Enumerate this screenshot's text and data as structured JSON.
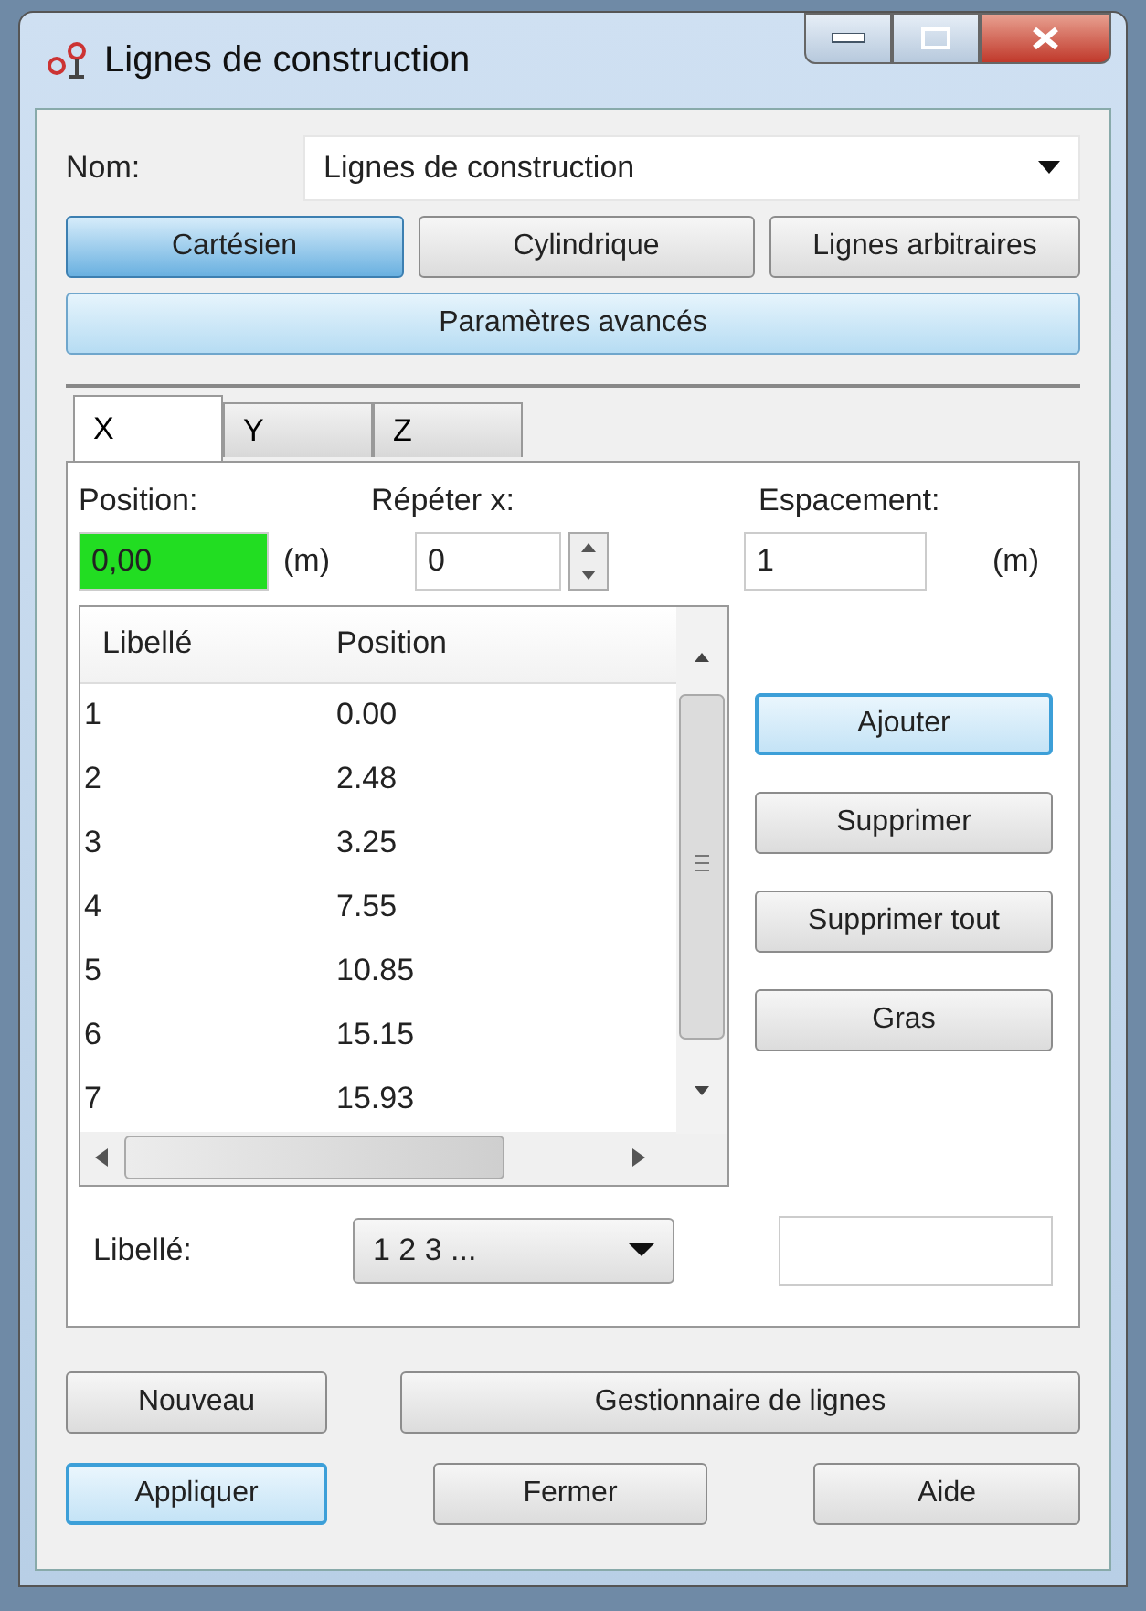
{
  "window": {
    "title": "Lignes de construction"
  },
  "name_field": {
    "label": "Nom:",
    "value": "Lignes de construction"
  },
  "modes": [
    {
      "label": "Cartésien",
      "selected": true
    },
    {
      "label": "Cylindrique",
      "selected": false
    },
    {
      "label": "Lignes arbitraires",
      "selected": false
    }
  ],
  "advanced_button": {
    "label": "Paramètres avancés"
  },
  "tabs": [
    {
      "label": "X",
      "selected": true
    },
    {
      "label": "Y",
      "selected": false
    },
    {
      "label": "Z",
      "selected": false
    }
  ],
  "position": {
    "label": "Position:",
    "value": "0,00",
    "highlighted": true,
    "unit": "(m)"
  },
  "repeat": {
    "label": "Répéter x:",
    "value": "0"
  },
  "spacing": {
    "label": "Espacement:",
    "value": "1",
    "unit": "(m)"
  },
  "table": {
    "columns": [
      "Libellé",
      "Position"
    ],
    "rows": [
      [
        "1",
        "0.00"
      ],
      [
        "2",
        "2.48"
      ],
      [
        "3",
        "3.25"
      ],
      [
        "4",
        "7.55"
      ],
      [
        "5",
        "10.85"
      ],
      [
        "6",
        "15.15"
      ],
      [
        "7",
        "15.93"
      ]
    ]
  },
  "side_buttons": [
    {
      "label": "Ajouter",
      "focused": true
    },
    {
      "label": "Supprimer",
      "focused": false
    },
    {
      "label": "Supprimer tout",
      "focused": false
    },
    {
      "label": "Gras",
      "focused": false
    }
  ],
  "label_select": {
    "label": "Libellé:",
    "value": "1 2 3 ..."
  },
  "bottom_buttons": [
    {
      "label": "Nouveau",
      "focused": false
    },
    {
      "label": "Gestionnaire de lignes",
      "focused": false
    },
    {
      "label": "Appliquer",
      "focused": true
    },
    {
      "label": "Fermer",
      "focused": false
    },
    {
      "label": "Aide",
      "focused": false
    }
  ]
}
